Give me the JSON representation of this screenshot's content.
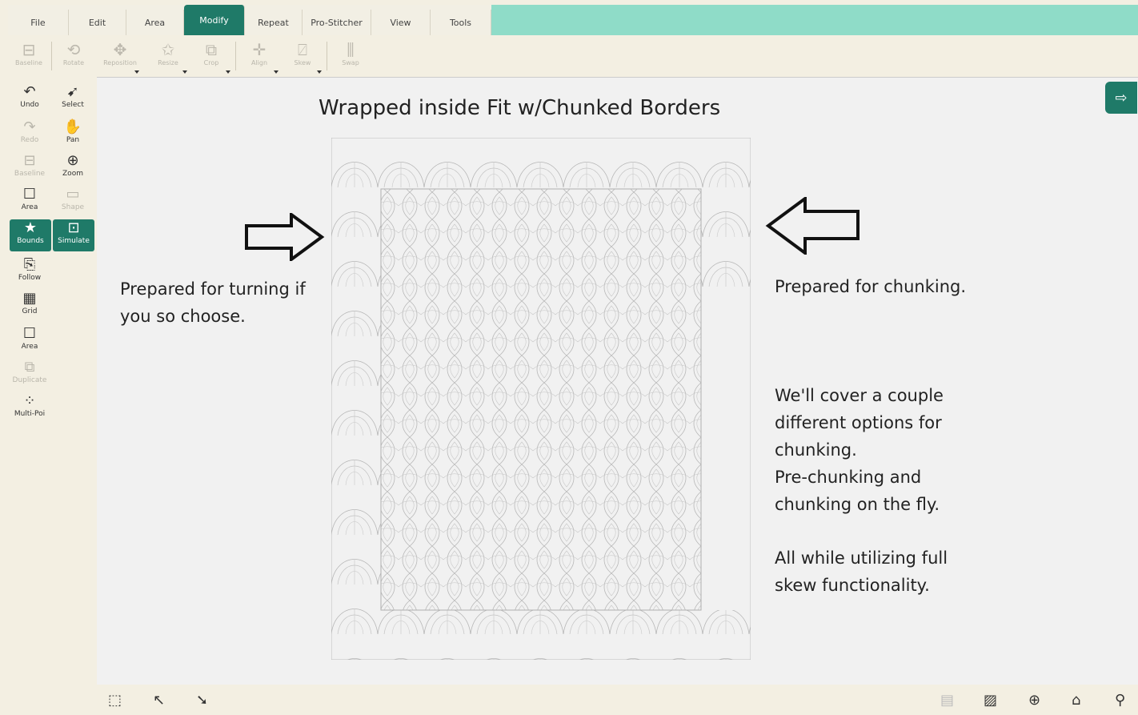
{
  "tabs": [
    {
      "label": "File"
    },
    {
      "label": "Edit"
    },
    {
      "label": "Area"
    },
    {
      "label": "Modify"
    },
    {
      "label": "Repeat"
    },
    {
      "label": "Pro-Stitcher"
    },
    {
      "label": "View"
    },
    {
      "label": "Tools"
    }
  ],
  "ribbon": [
    {
      "label": "Baseline",
      "icon": "baseline-icon"
    },
    {
      "label": "Rotate",
      "icon": "rotate-icon"
    },
    {
      "label": "Reposition",
      "icon": "reposition-icon"
    },
    {
      "label": "Resize",
      "icon": "resize-icon"
    },
    {
      "label": "Crop",
      "icon": "crop-icon"
    },
    {
      "label": "Align",
      "icon": "align-icon"
    },
    {
      "label": "Skew",
      "icon": "skew-icon"
    },
    {
      "label": "Swap",
      "icon": "swap-icon"
    }
  ],
  "sidebar": [
    {
      "label": "Undo",
      "icon": "undo-icon"
    },
    {
      "label": "Select",
      "icon": "select-icon"
    },
    {
      "label": "Redo",
      "icon": "redo-icon"
    },
    {
      "label": "Pan",
      "icon": "pan-icon"
    },
    {
      "label": "Baseline",
      "icon": "baseline-icon"
    },
    {
      "label": "Zoom",
      "icon": "zoom-icon"
    },
    {
      "label": "Area",
      "icon": "area-icon"
    },
    {
      "label": "Shape",
      "icon": "shape-icon"
    },
    {
      "label": "Bounds",
      "icon": "bounds-icon"
    },
    {
      "label": "Simulate",
      "icon": "simulate-icon"
    },
    {
      "label": "Follow",
      "icon": "follow-icon"
    },
    {
      "label": "Grid",
      "icon": "grid-icon"
    },
    {
      "label": "Area",
      "icon": "area-icon"
    },
    {
      "label": "Duplicate",
      "icon": "duplicate-icon"
    },
    {
      "label": "Multi-Poi",
      "icon": "multi-point-icon"
    }
  ],
  "canvas": {
    "title": "Wrapped inside Fit w/Chunked Borders",
    "left_note": [
      "Prepared for turning if",
      "you so choose."
    ],
    "right_note1": "Prepared for chunking.",
    "right_note2": [
      "We'll cover a couple",
      "different options for",
      "chunking.",
      "Pre-chunking and",
      "chunking on the fly."
    ],
    "right_note3": [
      "All while utilizing full",
      "skew functionality."
    ]
  },
  "colors": {
    "accent": "#1f7a68",
    "tabbar": "#8fdcc8",
    "canvas": "#f1f1f1"
  }
}
